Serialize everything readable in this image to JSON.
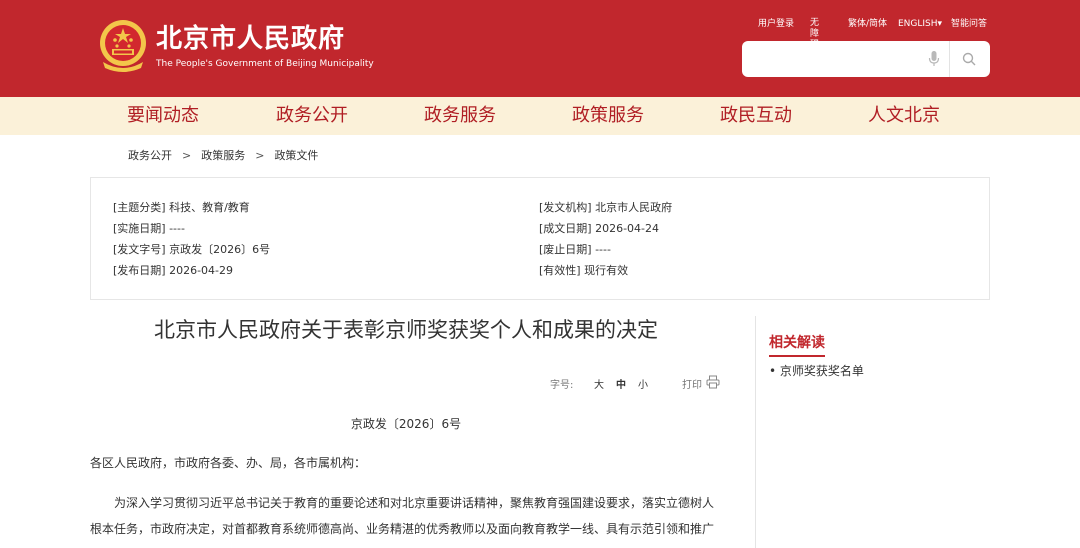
{
  "header": {
    "title": "北京市人民政府",
    "subtitle": "The People's Government of Beijing Municipality",
    "links": {
      "login": "用户登录",
      "accessibility": "无障碍",
      "traditional": "繁体/简体",
      "english": "ENGLISH▾",
      "qa": "智能问答"
    },
    "search_placeholder": ""
  },
  "nav": {
    "items": [
      "要闻动态",
      "政务公开",
      "政务服务",
      "政策服务",
      "政民互动",
      "人文北京"
    ]
  },
  "breadcrumb": [
    "政务公开",
    "政策服务",
    "政策文件"
  ],
  "meta": {
    "subject": "[主题分类] 科技、教育/教育",
    "effective_date": "[实施日期] ----",
    "doc_no": "[发文字号] 京政发〔2026〕6号",
    "publish_date": "[发布日期] 2026-04-29",
    "issuer": "[发文机构] 北京市人民政府",
    "written_date": "[成文日期] 2026-04-24",
    "repeal_date": "[废止日期] ----",
    "validity": "[有效性] 现行有效"
  },
  "article": {
    "title": "北京市人民政府关于表彰京师奖获奖个人和成果的决定",
    "font_size_label": "字号:",
    "font_large": "大",
    "font_medium": "中",
    "font_small": "小",
    "print_label": "打印",
    "doc_number": "京政发〔2026〕6号",
    "recipients": "各区人民政府，市政府各委、办、局，各市属机构：",
    "body": "为深入学习贯彻习近平总书记关于教育的重要论述和对北京重要讲话精神，聚焦教育强国建设要求，落实立德树人根本任务，市政府决定，对首都教育系统师德高尚、业务精湛的优秀教师以及面向教育教学一线、具有示范引领和推广价值的教育教学成果给予表彰。"
  },
  "sidebar": {
    "title": "相关解读",
    "links": [
      "• 京师奖获奖名单"
    ]
  },
  "colors": {
    "brand_red": "#c1272d",
    "nav_bg": "#fbf1d9"
  }
}
